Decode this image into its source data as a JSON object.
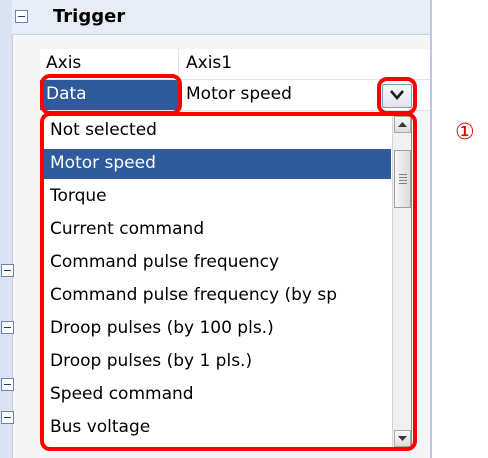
{
  "callout": "①",
  "trigger": {
    "title": "Trigger",
    "rows": [
      {
        "label": "Axis",
        "value": "Axis1"
      },
      {
        "label": "Data",
        "value": "Motor speed"
      }
    ]
  },
  "dropdown": {
    "selected": "Motor speed",
    "options": [
      "Not selected",
      "Motor speed",
      "Torque",
      "Current command",
      "Command pulse frequency",
      "Command pulse frequency (by sp",
      "Droop pulses (by 100 pls.)",
      "Droop pulses (by 1 pls.)",
      "Speed command",
      "Bus voltage"
    ]
  },
  "colors": {
    "highlight": "#ff0000",
    "selection": "#2f5b9d"
  },
  "icons": {
    "collapse": "minus-icon",
    "dropdown": "chevron-down-icon",
    "scroll_up": "triangle-up",
    "scroll_down": "triangle-down"
  }
}
